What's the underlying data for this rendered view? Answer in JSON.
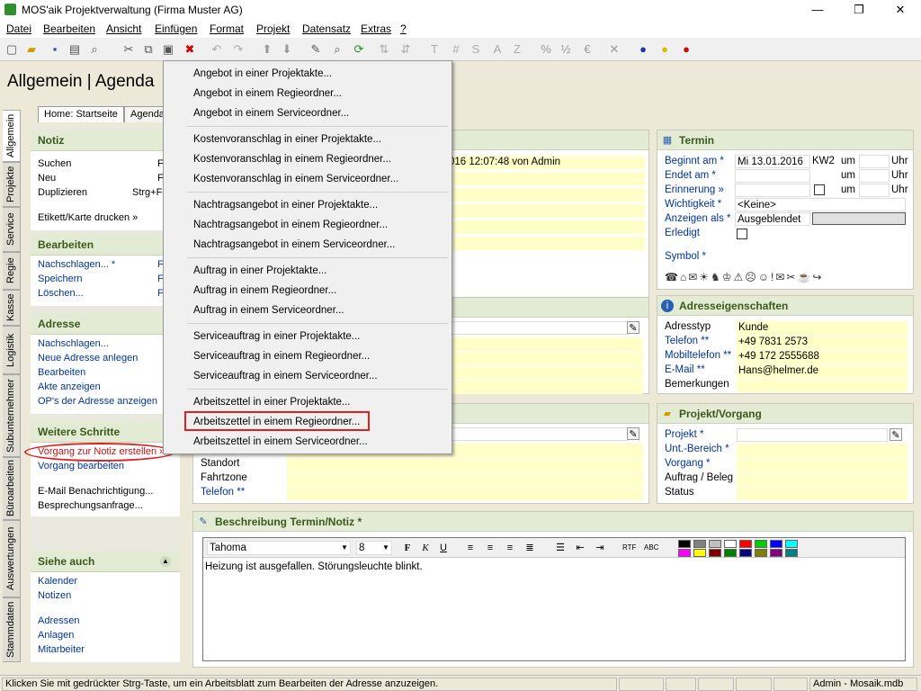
{
  "window": {
    "title": "MOS'aik Projektverwaltung (Firma Muster AG)",
    "min": "—",
    "max": "❐",
    "close": "✕"
  },
  "menu": [
    "Datei",
    "Bearbeiten",
    "Ansicht",
    "Einfügen",
    "Format",
    "Projekt",
    "Datensatz",
    "Extras",
    "?"
  ],
  "page_title": "Allgemein | Agenda",
  "vtabs": [
    "Allgemein",
    "Projekte",
    "Service",
    "Regie",
    "Kasse",
    "Logistik",
    "Subunternehmer",
    "Büroarbeiten",
    "Auswertungen",
    "Stammdaten"
  ],
  "htabs": [
    "Home: Startseite",
    "Agenda"
  ],
  "left": {
    "notiz": {
      "title": "Notiz",
      "items": [
        {
          "label": "Suchen",
          "key": "F"
        },
        {
          "label": "Neu",
          "key": "F"
        },
        {
          "label": "Duplizieren",
          "key": "Strg+F"
        }
      ],
      "extra": "Etikett/Karte drucken »"
    },
    "bearbeiten": {
      "title": "Bearbeiten",
      "items": [
        {
          "label": "Nachschlagen... *",
          "key": "F"
        },
        {
          "label": "Speichern",
          "key": "F"
        },
        {
          "label": "Löschen...",
          "key": "F"
        }
      ]
    },
    "adresse": {
      "title": "Adresse",
      "items": [
        "Nachschlagen...",
        "Neue Adresse anlegen",
        "Bearbeiten",
        "Akte anzeigen",
        "OP's der Adresse anzeigen"
      ]
    },
    "weitere": {
      "title": "Weitere Schritte",
      "items": [
        "Vorgang zur Notiz erstellen »",
        "Vorgang bearbeiten"
      ],
      "extra": [
        "E-Mail Benachrichtigung...",
        "Besprechungsanfrage..."
      ]
    },
    "siehe": {
      "title": "Siehe auch",
      "items": [
        "Kalender",
        "Notizen"
      ],
      "extra": [
        "Adressen",
        "Anlagen",
        "Mitarbeiter"
      ]
    }
  },
  "dropdown": [
    [
      "Angebot in einer Projektakte...",
      "Angebot in einem Regieordner...",
      "Angebot in einem Serviceordner..."
    ],
    [
      "Kostenvoranschlag in einer Projektakte...",
      "Kostenvoranschlag in einem Regieordner...",
      "Kostenvoranschlag in einem Serviceordner..."
    ],
    [
      "Nachtragsangebot in einer Projektakte...",
      "Nachtragsangebot in einem Regieordner...",
      "Nachtragsangebot in einem Serviceordner..."
    ],
    [
      "Auftrag in einer Projektakte...",
      "Auftrag in einem Regieordner...",
      "Auftrag in einem Serviceordner..."
    ],
    [
      "Serviceauftrag in einer Projektakte...",
      "Serviceauftrag in einem Regieordner...",
      "Serviceauftrag in einem Serviceordner..."
    ],
    [
      "Arbeitszettel in einer Projektakte...",
      "Arbeitszettel in einem Regieordner...",
      "Arbeitszettel in einem Serviceordner..."
    ]
  ],
  "notiz_created": "016 12:07:48 von Admin",
  "termin": {
    "title": "Termin",
    "beginnt": "Beginnt am *",
    "beginnt_val": "Mi 13.01.2016",
    "kw": "KW2",
    "um": "um",
    "uhr": "Uhr",
    "endet": "Endet am *",
    "erinnerung": "Erinnerung »",
    "wichtigkeit": "Wichtigkeit *",
    "wichtigkeit_val": "<Keine>",
    "anzeigen": "Anzeigen als *",
    "anzeigen_val": "Ausgeblendet",
    "erledigt": "Erledigt",
    "symbol": "Symbol *"
  },
  "adress": {
    "title": "Adresseigenschaften",
    "typ": "Adresstyp",
    "typ_val": "Kunde",
    "tel": "Telefon **",
    "tel_val": "+49 7831 2573",
    "mobil": "Mobiltelefon **",
    "mobil_val": "+49 172 2555688",
    "mail": "E-Mail **",
    "mail_val": "Hans@helmer.de",
    "bem": "Bemerkungen"
  },
  "projekt": {
    "title": "Projekt/Vorgang",
    "projekt": "Projekt *",
    "unt": "Unt.-Bereich *",
    "vorgang": "Vorgang *",
    "auftrag": "Auftrag / Beleg",
    "status": "Status"
  },
  "standort": {
    "standort": "Standort",
    "fahrtzone": "Fahrtzone",
    "telefon": "Telefon **"
  },
  "beschreibung": {
    "title": "Beschreibung Termin/Notiz *",
    "font": "Tahoma",
    "size": "8",
    "text": "Heizung ist ausgefallen. Störungsleuchte blinkt.",
    "bold": "F",
    "italic": "K",
    "underline": "U"
  },
  "status": {
    "msg": "Klicken Sie mit gedrückter Strg-Taste, um ein Arbeitsblatt zum Bearbeiten der Adresse anzuzeigen.",
    "user": "Admin - Mosaik.mdb"
  },
  "colors": {
    "highlight": "#e02020",
    "header_bg": "#e3ebd5",
    "field_bg": "#ffffc8"
  }
}
